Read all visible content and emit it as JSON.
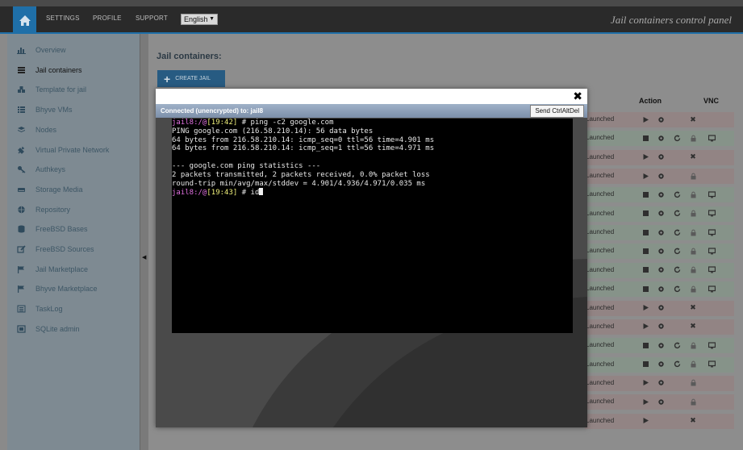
{
  "header": {
    "nav": [
      "SETTINGS",
      "PROFILE",
      "SUPPORT"
    ],
    "language": "English",
    "brand": "Jail containers control panel"
  },
  "sidebar": {
    "items": [
      {
        "label": "Overview",
        "icon": "bar-chart-icon"
      },
      {
        "label": "Jail containers",
        "icon": "server-icon",
        "active": true
      },
      {
        "label": "Template for jail",
        "icon": "cubes-icon"
      },
      {
        "label": "Bhyve VMs",
        "icon": "list-icon"
      },
      {
        "label": "Nodes",
        "icon": "stack-icon"
      },
      {
        "label": "Virtual Private Network",
        "icon": "plug-icon"
      },
      {
        "label": "Authkeys",
        "icon": "key-icon"
      },
      {
        "label": "Storage Media",
        "icon": "drive-icon"
      },
      {
        "label": "Repository",
        "icon": "globe-icon"
      },
      {
        "label": "FreeBSD Bases",
        "icon": "database-icon"
      },
      {
        "label": "FreeBSD Sources",
        "icon": "edit-icon"
      },
      {
        "label": "Jail Marketplace",
        "icon": "flag-icon"
      },
      {
        "label": "Bhyve Marketplace",
        "icon": "flag-icon"
      },
      {
        "label": "TaskLog",
        "icon": "list-alt-icon"
      },
      {
        "label": "SQLite admin",
        "icon": "box-icon"
      }
    ]
  },
  "main": {
    "title": "Jail containers:",
    "create_button": "CREATE JAIL",
    "columns": {
      "action": "Action",
      "vnc": "VNC"
    },
    "rows": [
      {
        "status": "Launched",
        "state": "stopped"
      },
      {
        "status": "Launched",
        "state": "running"
      },
      {
        "status": "Launched",
        "state": "stopped"
      },
      {
        "status": "Launched",
        "state": "stopped-locked"
      },
      {
        "status": "Launched",
        "state": "running"
      },
      {
        "status": "Launched",
        "state": "running"
      },
      {
        "status": "Launched",
        "state": "running"
      },
      {
        "status": "Launched",
        "state": "running"
      },
      {
        "status": "Launched",
        "state": "running"
      },
      {
        "status": "Launched",
        "state": "running"
      },
      {
        "status": "Launched",
        "state": "stopped"
      },
      {
        "status": "Launched",
        "state": "stopped"
      },
      {
        "status": "Launched",
        "state": "running"
      },
      {
        "status": "Launched",
        "state": "running"
      },
      {
        "status": "Launched",
        "state": "stopped-locked"
      },
      {
        "status": "Launched",
        "state": "stopped-locked"
      },
      {
        "status": "Launched",
        "state": "stopped-noconf"
      }
    ]
  },
  "modal": {
    "connection": "Connected (unencrypted) to: jail8",
    "send_cad": "Send CtrlAltDel",
    "terminal": [
      {
        "user": "jail8:/@",
        "time": "[19:42]",
        "cmd": " # ping -c2 google.com"
      },
      {
        "text": "PING google.com (216.58.210.14): 56 data bytes"
      },
      {
        "text": "64 bytes from 216.58.210.14: icmp_seq=0 ttl=56 time=4.901 ms"
      },
      {
        "text": "64 bytes from 216.58.210.14: icmp_seq=1 ttl=56 time=4.971 ms"
      },
      {
        "text": ""
      },
      {
        "text": "--- google.com ping statistics ---"
      },
      {
        "text": "2 packets transmitted, 2 packets received, 0.0% packet loss"
      },
      {
        "text": "round-trip min/avg/max/stddev = 4.901/4.936/4.971/0.035 ms"
      },
      {
        "user": "jail8:/@",
        "time": "[19:43]",
        "cmd": " # id"
      }
    ]
  }
}
